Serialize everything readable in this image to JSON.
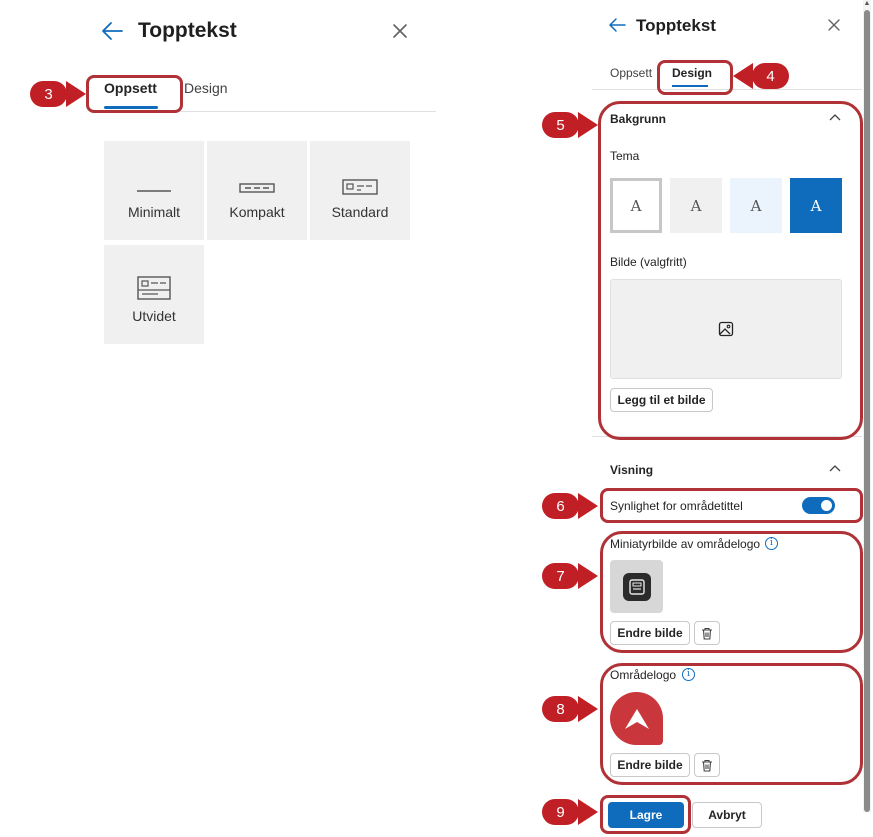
{
  "left_panel": {
    "title": "Topptekst",
    "tabs": [
      "Oppsett",
      "Design"
    ],
    "layouts": [
      "Minimalt",
      "Kompakt",
      "Standard",
      "Utvidet"
    ]
  },
  "right_panel": {
    "title": "Topptekst",
    "tabs": [
      "Oppsett",
      "Design"
    ],
    "background": {
      "title": "Bakgrunn",
      "theme_label": "Tema",
      "theme_glyph": "A",
      "theme_colors": [
        "#ffffff",
        "#f0f0f0",
        "#ebf3fc",
        "#0f6cbd"
      ],
      "image_label": "Bilde (valgfritt)",
      "add_image_button": "Legg til et bilde"
    },
    "display": {
      "title": "Visning",
      "site_title_visibility": "Synlighet for områdetittel",
      "site_title_visible": true,
      "thumbnail_label": "Miniatyrbilde av områdelogo",
      "thumbnail_change_button": "Endre bilde",
      "logo_label": "Områdelogo",
      "logo_change_button": "Endre bilde",
      "info_glyph": "i"
    },
    "save_button": "Lagre",
    "cancel_button": "Avbryt"
  },
  "callouts": [
    "3",
    "4",
    "5",
    "6",
    "7",
    "8",
    "9"
  ],
  "colors": {
    "accent": "#0f6cbd",
    "callout": "#c01f25",
    "highlight_border": "#b03236",
    "logo_red": "#c9363b"
  }
}
